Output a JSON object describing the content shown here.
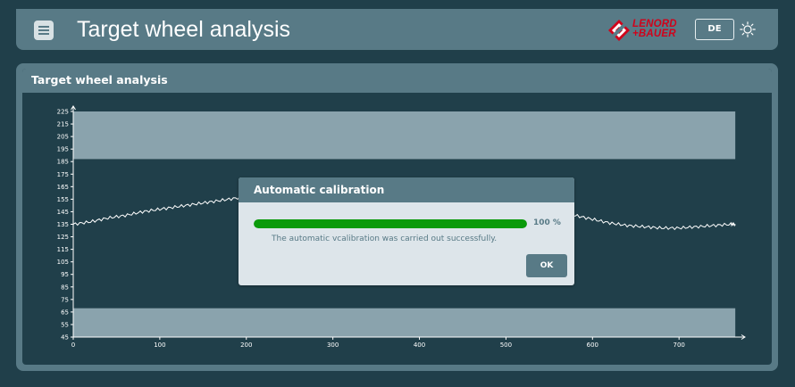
{
  "header": {
    "title": "Target wheel analysis",
    "logo_line1": "LENORD",
    "logo_line2": "+BAUER",
    "language": "DE",
    "menu_icon": "hamburger-menu-icon",
    "theme_icon": "sun-icon"
  },
  "panel": {
    "title": "Target wheel analysis"
  },
  "colors": {
    "background": "#203f4a",
    "bar": "#587a86",
    "band": "#8aa3ad",
    "brand_red": "#d0021b",
    "progress": "#0a9a0a"
  },
  "chart_data": {
    "type": "line",
    "xlim": [
      0,
      770
    ],
    "ylim": [
      45,
      225
    ],
    "x_ticks": [
      0,
      100,
      200,
      300,
      400,
      500,
      600,
      700
    ],
    "y_ticks": [
      45,
      55,
      65,
      75,
      85,
      95,
      105,
      115,
      125,
      135,
      145,
      155,
      165,
      175,
      185,
      195,
      205,
      215,
      225
    ],
    "bands": [
      {
        "y_from": 187,
        "y_to": 225
      },
      {
        "y_from": 45,
        "y_to": 68
      }
    ],
    "series": [
      {
        "x": [
          0,
          20,
          40,
          60,
          80,
          100,
          120,
          140,
          160,
          180,
          200,
          220,
          240,
          260,
          280,
          300,
          320,
          340,
          360,
          380,
          400,
          420,
          440,
          460,
          480,
          500,
          520,
          540,
          560,
          580,
          600,
          620,
          640,
          660,
          680,
          700,
          720,
          740,
          760,
          765
        ],
        "y": [
          135,
          137,
          140,
          142,
          145,
          147,
          149,
          151,
          153,
          155,
          157,
          158,
          158,
          157,
          156,
          155,
          154,
          153,
          153,
          152,
          151,
          150,
          150,
          149,
          148,
          147,
          146,
          145,
          144,
          142,
          139,
          136,
          134,
          133,
          132,
          132,
          133,
          134,
          135,
          135
        ]
      }
    ]
  },
  "dialog": {
    "title": "Automatic calibration",
    "progress": 100,
    "progress_label": "100 %",
    "message": "The automatic vcalibration was carried out successfully.",
    "ok_label": "OK"
  }
}
